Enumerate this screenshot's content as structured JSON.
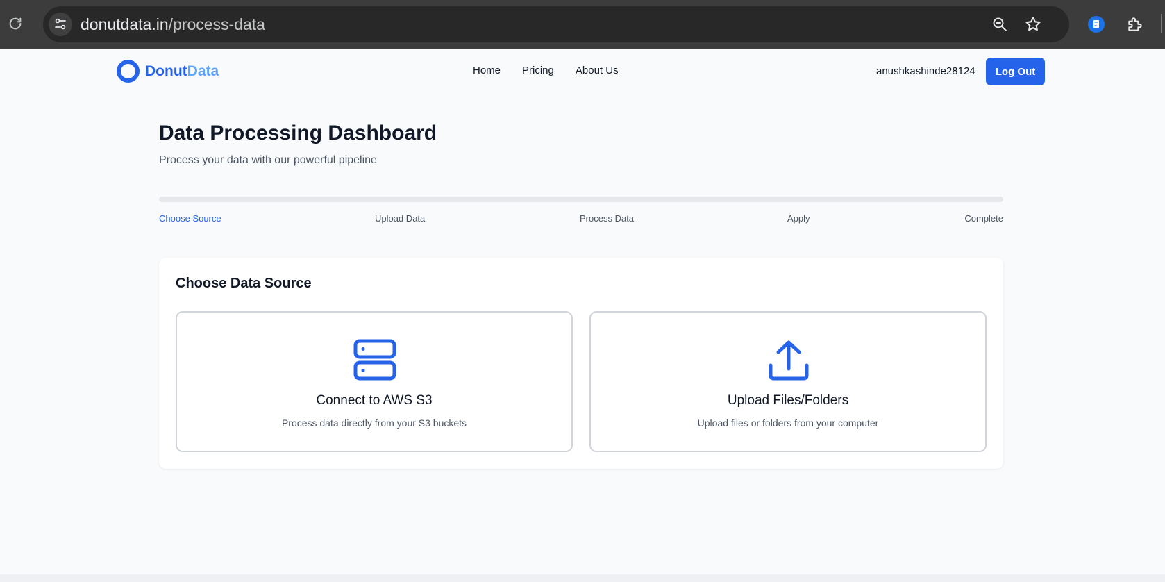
{
  "browser": {
    "url_host": "donutdata.in",
    "url_path": "/process-data"
  },
  "nav": {
    "logo_primary": "Donut",
    "logo_secondary": "Data",
    "links": [
      "Home",
      "Pricing",
      "About Us"
    ],
    "username": "anushkashinde28124",
    "logout_label": "Log Out"
  },
  "header": {
    "title": "Data Processing Dashboard",
    "subtitle": "Process your data with our powerful pipeline"
  },
  "progress": {
    "value_percent": 0,
    "steps": [
      "Choose Source",
      "Upload Data",
      "Process Data",
      "Apply",
      "Complete"
    ],
    "active_step": "Choose Source"
  },
  "source_card": {
    "title": "Choose Data Source",
    "options": [
      {
        "icon": "server-icon",
        "title": "Connect to AWS S3",
        "description": "Process data directly from your S3 buckets"
      },
      {
        "icon": "upload-icon",
        "title": "Upload Files/Folders",
        "description": "Upload files or folders from your computer"
      }
    ]
  },
  "colors": {
    "accent": "#2563eb",
    "accent_light": "#60a5fa",
    "chrome_bg": "#3c3c3c",
    "page_bg": "#f9fafb"
  }
}
